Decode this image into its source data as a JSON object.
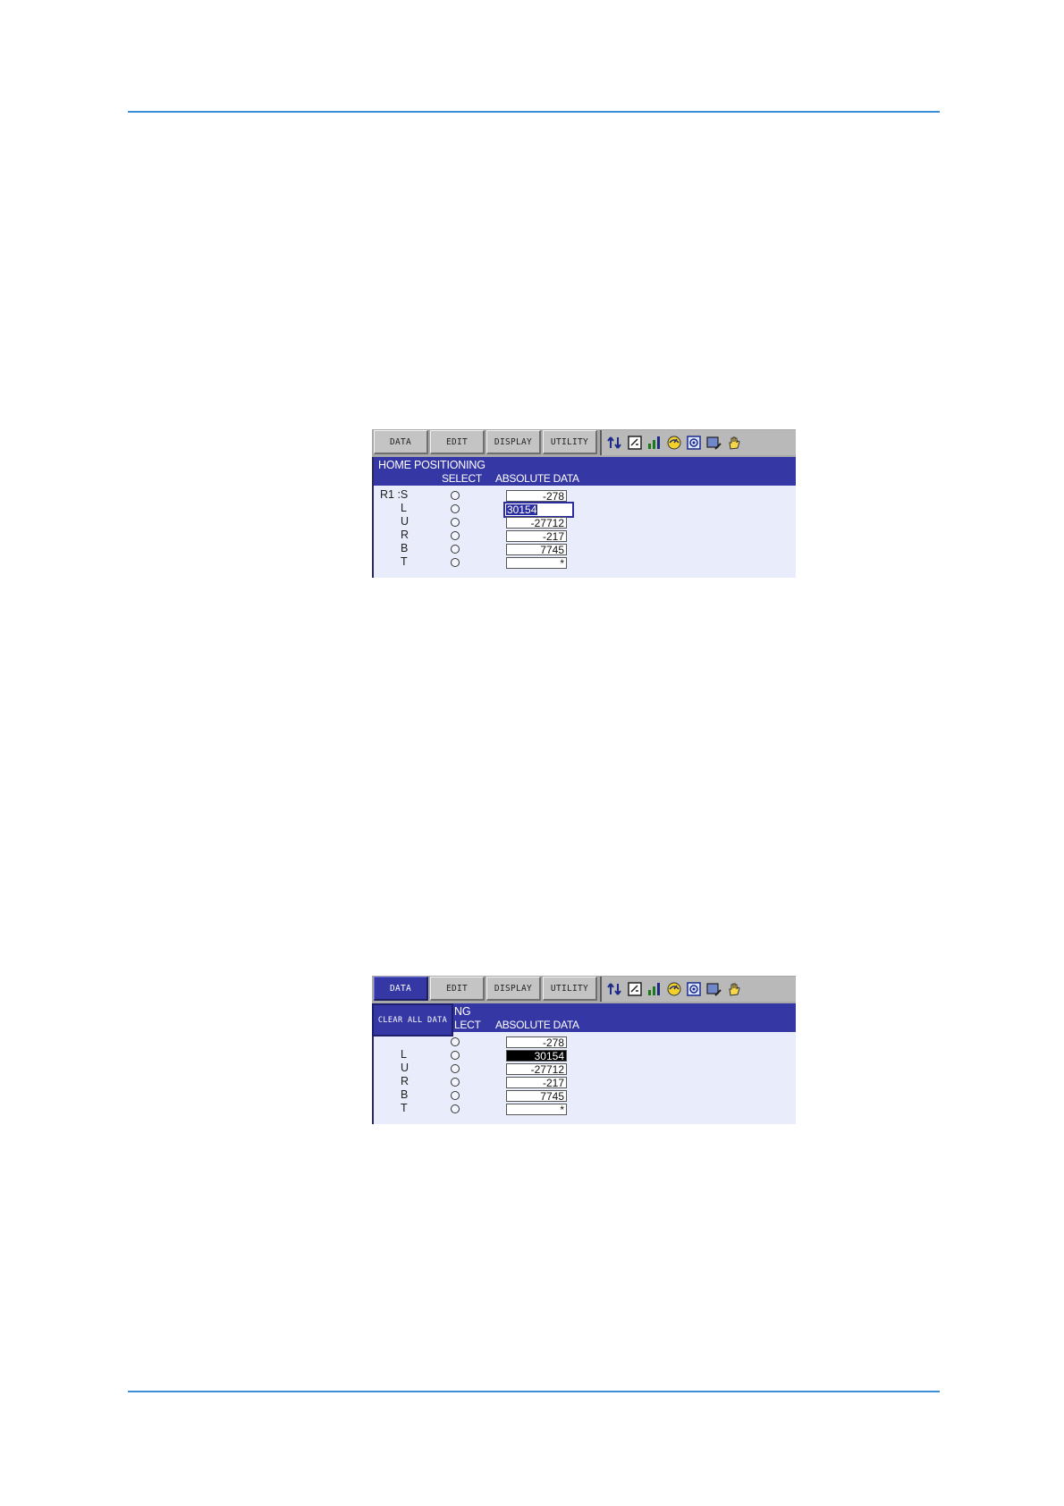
{
  "menu": {
    "data": "DATA",
    "edit": "EDIT",
    "display": "DISPLAY",
    "utility": "UTILITY"
  },
  "icons": [
    "switch-arrows-icon",
    "edit-document-icon",
    "signal-bars-icon",
    "speed-icon",
    "robot-target-icon",
    "screen-edit-icon",
    "hand-icon"
  ],
  "screen1": {
    "title": "HOME POSITIONING",
    "col_select": "SELECT",
    "col_absolute": "ABSOLUTE DATA",
    "robot": "R1",
    "axes": [
      {
        "label": "R1 :S",
        "value": "-278"
      },
      {
        "label": "L",
        "value": "30154"
      },
      {
        "label": "U",
        "value": "-27712"
      },
      {
        "label": "R",
        "value": "-217"
      },
      {
        "label": "B",
        "value": "7745"
      },
      {
        "label": "T",
        "value": "*"
      }
    ]
  },
  "screen2": {
    "title_fragment": "NG",
    "col_select_fragment": "LECT",
    "col_absolute": "ABSOLUTE DATA",
    "dropdown_item": "CLEAR ALL DATA",
    "axes": [
      {
        "label": "L",
        "value": "30154"
      },
      {
        "label": "U",
        "value": "-27712"
      },
      {
        "label": "R",
        "value": "-217"
      },
      {
        "label": "B",
        "value": "7745"
      },
      {
        "label": "T",
        "value": "*"
      }
    ],
    "first_value": "-278"
  }
}
